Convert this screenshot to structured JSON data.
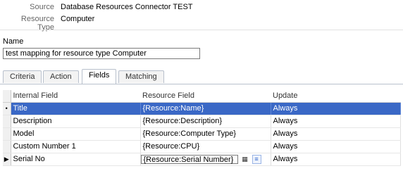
{
  "header": {
    "source_label": "Source",
    "source_value": "Database Resources Connector TEST",
    "resource_type_label": "Resource Type",
    "resource_type_value": "Computer"
  },
  "name_section": {
    "label": "Name",
    "value": "test mapping for resource type Computer"
  },
  "tabs": [
    {
      "label": "Criteria",
      "active": false
    },
    {
      "label": "Action",
      "active": false
    },
    {
      "label": "Fields",
      "active": true
    },
    {
      "label": "Matching",
      "active": false
    }
  ],
  "grid": {
    "columns": [
      "Internal Field",
      "Resource Field",
      "Update"
    ],
    "rows": [
      {
        "indicator": "•",
        "internal": "Title",
        "resource": "{Resource:Name}",
        "update": "Always",
        "selected": true
      },
      {
        "indicator": "",
        "internal": "Description",
        "resource": "{Resource:Description}",
        "update": "Always",
        "selected": false
      },
      {
        "indicator": "",
        "internal": "Model",
        "resource": "{Resource:Computer Type}",
        "update": "Always",
        "selected": false
      },
      {
        "indicator": "",
        "internal": "Custom Number 1",
        "resource": "{Resource:CPU}",
        "update": "Always",
        "selected": false
      },
      {
        "indicator": "▶",
        "internal": "Serial No",
        "resource": "{Resource:Serial Number}",
        "update": "Always",
        "selected": false,
        "editing": true
      }
    ],
    "edit_icons": [
      "field-picker-icon",
      "list-icon"
    ]
  },
  "colors": {
    "selection": "#3a68c6",
    "tab_border": "#b8c0cc"
  }
}
